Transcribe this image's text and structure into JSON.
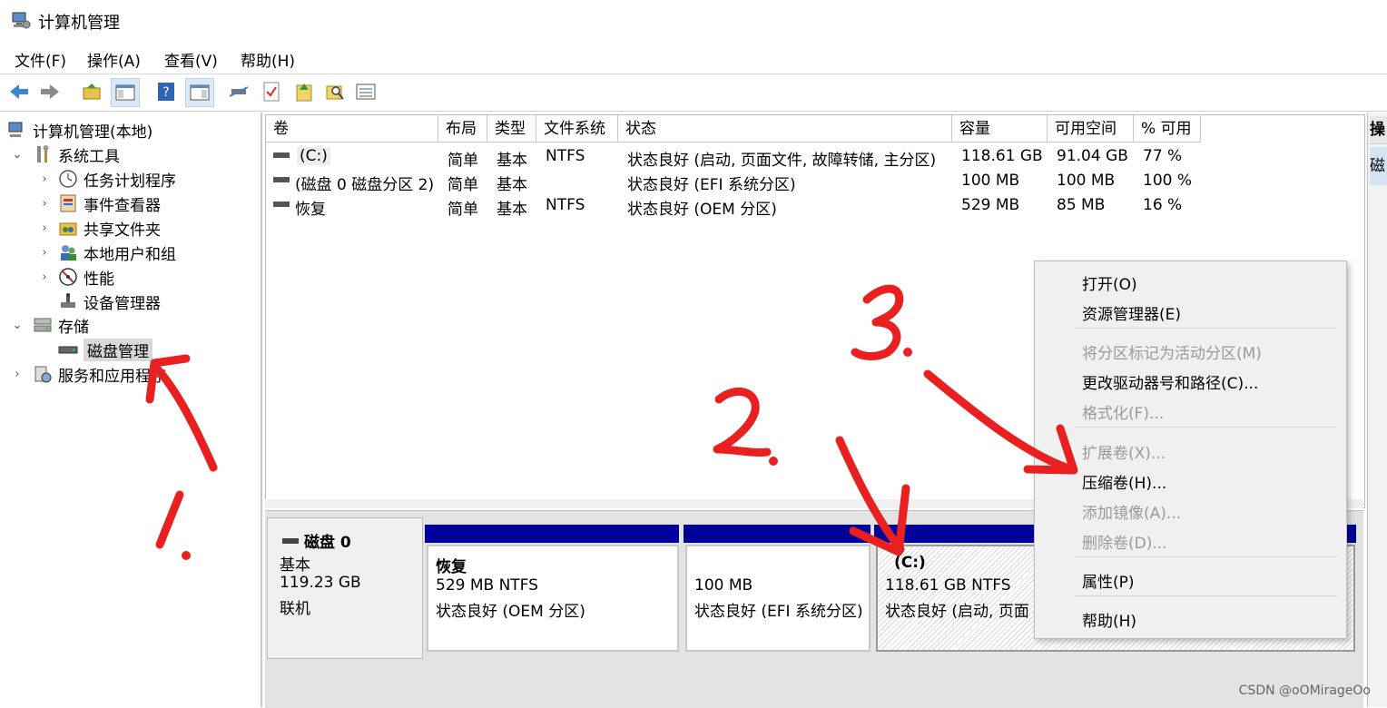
{
  "window": {
    "title": "计算机管理"
  },
  "menu": [
    "文件(F)",
    "操作(A)",
    "查看(V)",
    "帮助(H)"
  ],
  "tree": {
    "root": "计算机管理(本地)",
    "system_tools": "系统工具",
    "task_scheduler": "任务计划程序",
    "event_viewer": "事件查看器",
    "shared_folders": "共享文件夹",
    "local_users": "本地用户和组",
    "performance": "性能",
    "device_manager": "设备管理器",
    "storage": "存储",
    "disk_management": "磁盘管理",
    "services_apps": "服务和应用程序"
  },
  "columns": [
    "卷",
    "布局",
    "类型",
    "文件系统",
    "状态",
    "容量",
    "可用空间",
    "% 可用"
  ],
  "volumes": [
    [
      "(C:)",
      "简单",
      "基本",
      "NTFS",
      "状态良好 (启动, 页面文件, 故障转储, 主分区)",
      "118.61 GB",
      "91.04 GB",
      "77 %"
    ],
    [
      "(磁盘 0 磁盘分区 2)",
      "简单",
      "基本",
      "",
      "状态良好 (EFI 系统分区)",
      "100 MB",
      "100 MB",
      "100 %"
    ],
    [
      "恢复",
      "简单",
      "基本",
      "NTFS",
      "状态良好 (OEM 分区)",
      "529 MB",
      "85 MB",
      "16 %"
    ]
  ],
  "disk": {
    "name": "磁盘 0",
    "type": "基本",
    "size": "119.23 GB",
    "status": "联机"
  },
  "partitions": [
    {
      "title": "恢复",
      "size": "529 MB NTFS",
      "status": "状态良好 (OEM 分区)"
    },
    {
      "title": "",
      "size": "100 MB",
      "status": "状态良好 (EFI 系统分区)"
    },
    {
      "title": "(C:)",
      "size": "118.61 GB NTFS",
      "status": "状态良好 (启动, 页面"
    }
  ],
  "context_menu": {
    "open": "打开(O)",
    "explore": "资源管理器(E)",
    "mark_active": "将分区标记为活动分区(M)",
    "change_letter": "更改驱动器号和路径(C)...",
    "format": "格式化(F)...",
    "extend": "扩展卷(X)...",
    "shrink": "压缩卷(H)...",
    "add_mirror": "添加镜像(A)...",
    "delete": "删除卷(D)...",
    "properties": "属性(P)",
    "help": "帮助(H)"
  },
  "action_pane": {
    "header": "操",
    "item": "磁"
  },
  "watermark": "CSDN @oOMirageOo",
  "colors": {
    "partition_bar": "#00009a",
    "annotation": "#e8201f",
    "selection": "#d8d8d8"
  }
}
